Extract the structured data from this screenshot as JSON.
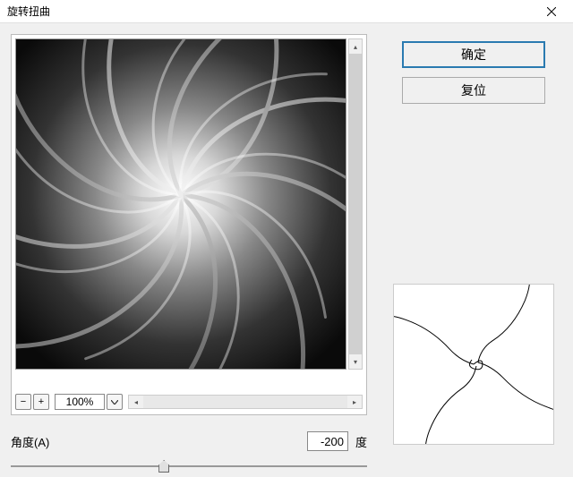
{
  "dialog": {
    "title": "旋转扭曲",
    "close_icon": "close"
  },
  "buttons": {
    "ok_label": "确定",
    "reset_label": "复位"
  },
  "zoom": {
    "minus_icon": "−",
    "plus_icon": "+",
    "value": "100%",
    "dropdown_icon": "v"
  },
  "angle": {
    "label": "角度(A)",
    "value": "-200",
    "unit": "度"
  }
}
